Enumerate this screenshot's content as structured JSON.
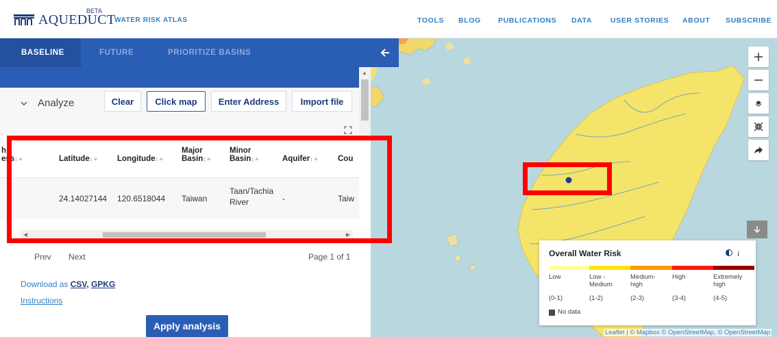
{
  "header": {
    "logo_text": "AQUEDUCT",
    "logo_badge": "BETA",
    "app_name": "WATER RISK ATLAS",
    "nav": [
      "TOOLS",
      "BLOG",
      "PUBLICATIONS",
      "DATA",
      "USER STORIES",
      "ABOUT",
      "SUBSCRIBE"
    ]
  },
  "tabs": [
    "BASELINE",
    "FUTURE",
    "PRIORITIZE BASINS"
  ],
  "analyze": {
    "label": "Analyze",
    "buttons": [
      "Clear",
      "Click map",
      "Enter Address",
      "Import file"
    ],
    "selected_button": "Click map"
  },
  "table": {
    "headers": [
      {
        "line1": "h",
        "line2": "ess"
      },
      {
        "line1": "",
        "line2": "Latitude"
      },
      {
        "line1": "",
        "line2": "Longitude"
      },
      {
        "line1": "Major",
        "line2": "Basin"
      },
      {
        "line1": "Minor",
        "line2": "Basin"
      },
      {
        "line1": "",
        "line2": "Aquifer"
      },
      {
        "line1": "",
        "line2": "Cou"
      }
    ],
    "sort_glyph": "↕ ≡",
    "rows": [
      {
        "latitude": "24.14027144",
        "longitude": "120.6518044",
        "major_basin": "Taiwan",
        "minor_basin_1": "Taan/Tachia",
        "minor_basin_2": "River",
        "aquifer": "-",
        "country": "Taiw"
      }
    ]
  },
  "pager": {
    "prev": "Prev",
    "next": "Next",
    "page": "Page 1 of 1"
  },
  "download": {
    "prefix": "Download as",
    "csv": "CSV,",
    "gpkg": "GPKG"
  },
  "instructions": "Instructions",
  "apply_button": "Apply analysis",
  "map": {
    "legend": {
      "title": "Overall Water Risk",
      "info": "i",
      "categories": [
        {
          "l1": "Low",
          "l2": "",
          "range": "(0-1)",
          "color": "#ffff99"
        },
        {
          "l1": "Low -",
          "l2": "Medium",
          "range": "(1-2)",
          "color": "#ffe600"
        },
        {
          "l1": "Medium-",
          "l2": "high",
          "range": "(2-3)",
          "color": "#ff9900"
        },
        {
          "l1": "High",
          "l2": "",
          "range": "(3-4)",
          "color": "#ff1900"
        },
        {
          "l1": "Extremely",
          "l2": "high",
          "range": "(4-5)",
          "color": "#990000"
        }
      ],
      "no_data": "No data"
    },
    "attribution_leaflet": "Leaflet",
    "attribution_rest": "| © Mapbox © OpenStreetMap, © OpenStreetMap",
    "controls": [
      "zoom-in",
      "zoom-out",
      "layers",
      "fullscreen",
      "share"
    ]
  },
  "colors": {
    "brand_blue": "#2a5eb5",
    "link_blue": "#2f7fc4",
    "annotation_red": "#ff0000",
    "map_land_yellow": "#f5e46a",
    "map_water": "#b9d7de"
  }
}
